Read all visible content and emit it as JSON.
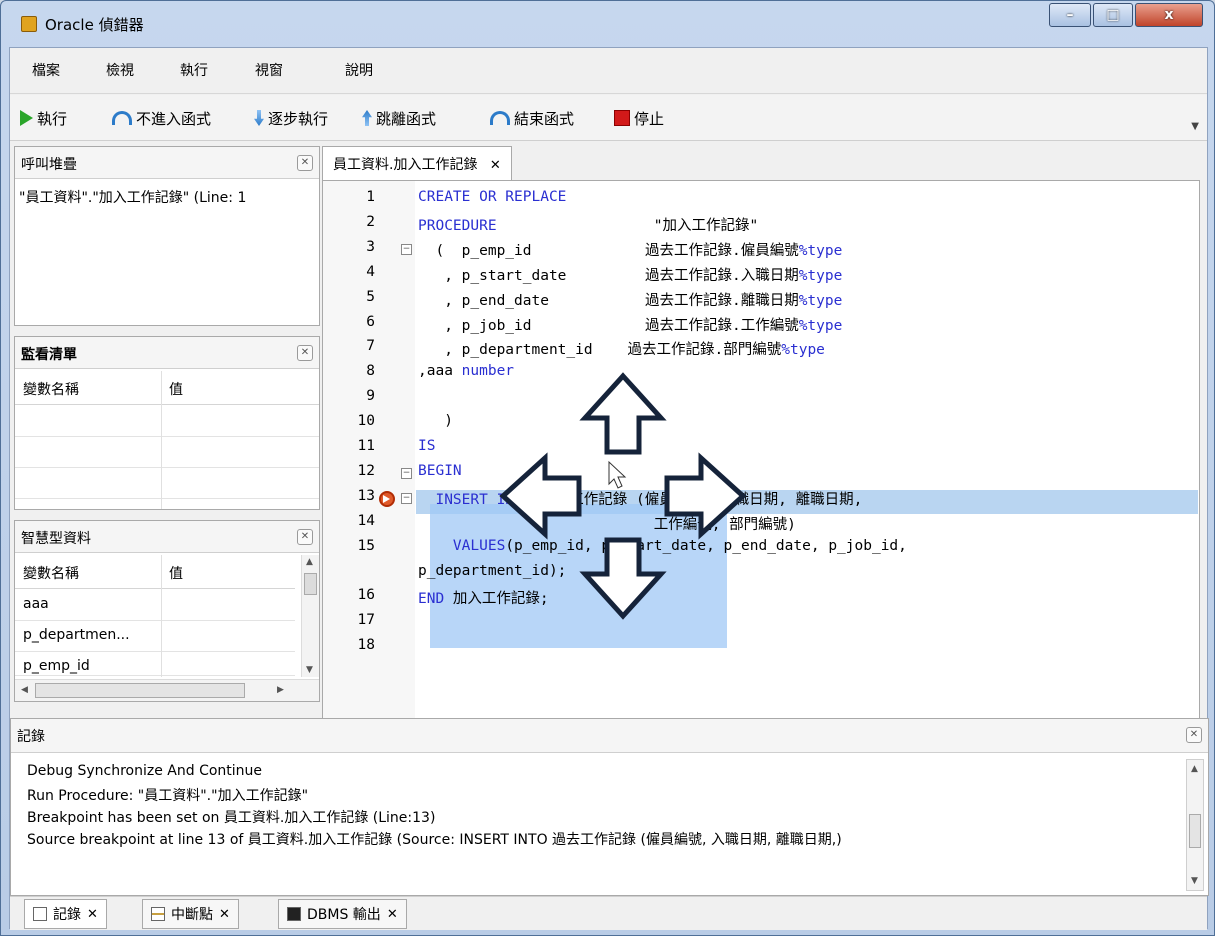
{
  "window": {
    "title": "Oracle 偵錯器",
    "min_glyph": "–",
    "max_glyph": "□",
    "close_glyph": "x"
  },
  "menu": [
    "檔案",
    "檢視",
    "執行",
    "視窗",
    "說明"
  ],
  "toolbar": {
    "run": "執行",
    "step_over": "不進入函式",
    "step_into": "逐步執行",
    "step_out": "跳離函式",
    "finish": "結束函式",
    "stop": "停止"
  },
  "call_stack": {
    "title": "呼叫堆疊",
    "items": [
      "\"員工資料\".\"加入工作記錄\" (Line: 1"
    ]
  },
  "watch": {
    "title": "監看清單",
    "columns": [
      "變數名稱",
      "值"
    ]
  },
  "smart_data": {
    "title": "智慧型資料",
    "columns": [
      "變數名稱",
      "值"
    ],
    "rows": [
      "aaa",
      "p_departmen...",
      "p_emp_id"
    ]
  },
  "editor": {
    "tab_label": "員工資料.加入工作記錄",
    "lines": [
      {
        "n": "1",
        "text": "CREATE OR REPLACE"
      },
      {
        "n": "2",
        "text": "PROCEDURE                  \"加入工作記錄\""
      },
      {
        "n": "3",
        "text": "  (  p_emp_id             過去工作記錄.僱員編號%type"
      },
      {
        "n": "4",
        "text": "   , p_start_date         過去工作記錄.入職日期%type"
      },
      {
        "n": "5",
        "text": "   , p_end_date           過去工作記錄.離職日期%type"
      },
      {
        "n": "6",
        "text": "   , p_job_id             過去工作記錄.工作編號%type"
      },
      {
        "n": "7",
        "text": "   , p_department_id    過去工作記錄.部門編號%type"
      },
      {
        "n": "8",
        "text": ",aaa number"
      },
      {
        "n": "9",
        "text": ""
      },
      {
        "n": "10",
        "text": "   )"
      },
      {
        "n": "11",
        "text": "IS"
      },
      {
        "n": "12",
        "text": "BEGIN"
      },
      {
        "n": "13",
        "text": "  INSERT INTO 過去工作記錄 (僱員編號, 入職日期, 離職日期,"
      },
      {
        "n": "14",
        "text": "                           工作編號, 部門編號)"
      },
      {
        "n": "15",
        "text": "    VALUES(p_emp_id, p_start_date, p_end_date, p_job_id,"
      },
      {
        "n": "",
        "text": "p_department_id);"
      },
      {
        "n": "16",
        "text": "END 加入工作記錄;"
      },
      {
        "n": "17",
        "text": ""
      },
      {
        "n": "18",
        "text": ""
      }
    ]
  },
  "log": {
    "title": "記錄",
    "lines": [
      "Debug Synchronize And Continue",
      "Run Procedure: \"員工資料\".\"加入工作記錄\"",
      "Breakpoint has been set on 員工資料.加入工作記錄 (Line:13)",
      "Source breakpoint at line 13 of 員工資料.加入工作記錄 (Source:   INSERT INTO 過去工作記錄 (僱員編號, 入職日期, 離職日期,)"
    ]
  },
  "bottom_tabs": [
    "記錄",
    "中斷點",
    "DBMS 輸出"
  ],
  "colors": {
    "keyword": "#2a2fd1",
    "highlight": "#b9d5f1",
    "selection": "#a0c8f5",
    "breakpoint": "#e05a2a"
  }
}
